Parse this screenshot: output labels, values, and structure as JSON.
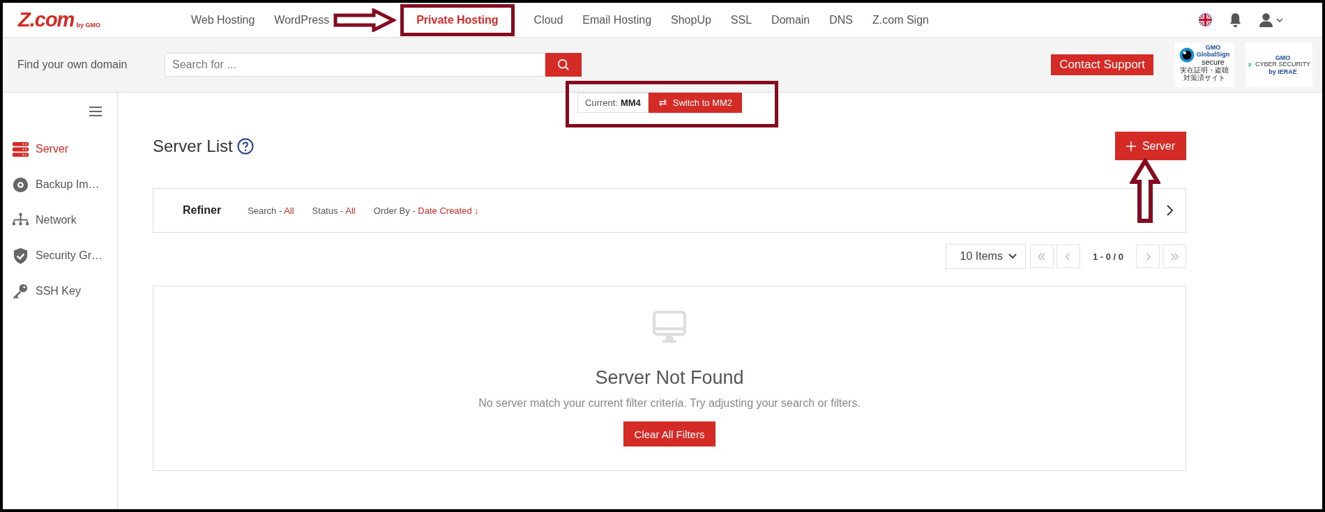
{
  "header": {
    "logo": "Z.com",
    "logo_tagline": "by GMO",
    "nav": [
      {
        "label": "Web Hosting",
        "selected": false
      },
      {
        "label": "WordPress",
        "selected": false
      },
      {
        "label": "Private Hosting",
        "selected": true
      },
      {
        "label": "Cloud",
        "selected": false
      },
      {
        "label": "Email Hosting",
        "selected": false
      },
      {
        "label": "ShopUp",
        "selected": false
      },
      {
        "label": "SSL",
        "selected": false
      },
      {
        "label": "Domain",
        "selected": false
      },
      {
        "label": "DNS",
        "selected": false
      },
      {
        "label": "Z.com Sign",
        "selected": false
      }
    ]
  },
  "search_bar": {
    "label": "Find your own domain",
    "placeholder": "Search for ...",
    "contact_button": "Contact Support",
    "badges": [
      {
        "kind": "globalsign",
        "brand": "GMO",
        "title": "GlobalSign",
        "subtitle": "secure",
        "caption": "実在証明・盗聴対策済サイト"
      },
      {
        "kind": "cyber",
        "brand": "GMO",
        "title": "CYBER SECURITY",
        "subtitle": "by IERAE"
      }
    ]
  },
  "version_switch": {
    "label": "Current:",
    "current": "MM4",
    "button": "Switch to MM2"
  },
  "sidebar": {
    "items": [
      {
        "kind": "server",
        "label": "Server",
        "selected": true
      },
      {
        "kind": "disc",
        "label": "Backup Im…",
        "selected": false
      },
      {
        "kind": "network",
        "label": "Network",
        "selected": false
      },
      {
        "kind": "shield",
        "label": "Security Gr…",
        "selected": false
      },
      {
        "kind": "key",
        "label": "SSH Key",
        "selected": false
      }
    ]
  },
  "page": {
    "title": "Server List",
    "add_button": "Server",
    "refiner": {
      "title": "Refiner",
      "filters": [
        {
          "label": "Search -",
          "value": "All"
        },
        {
          "label": "Status -",
          "value": "All"
        },
        {
          "label": "Order By -",
          "value": "Date Created ↓"
        }
      ]
    },
    "pagination": {
      "per_page": "10 Items",
      "range": "1 - 0 / 0"
    },
    "empty": {
      "title": "Server Not Found",
      "message": "No server match your current filter criteria. Try adjusting your search or filters.",
      "button": "Clear All Filters"
    }
  }
}
